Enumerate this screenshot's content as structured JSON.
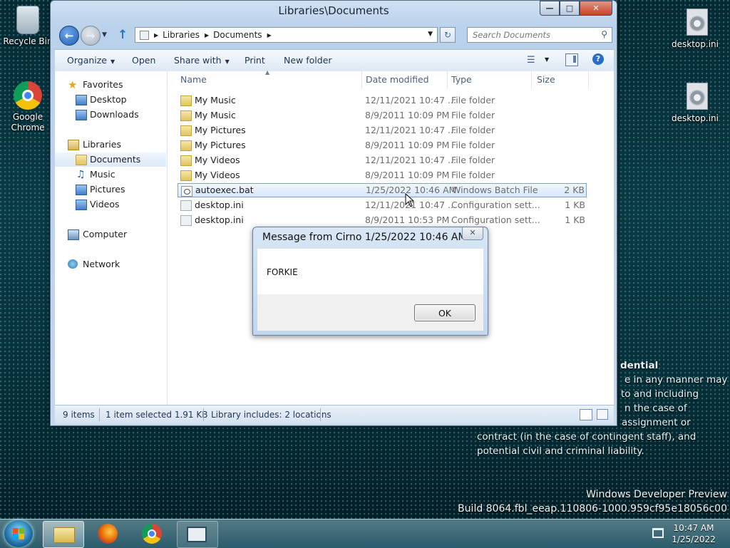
{
  "desktop": {
    "icons": [
      {
        "label": "Recycle Bin",
        "icon": "recycle-bin-icon"
      },
      {
        "label": "Google Chrome",
        "icon": "chrome-icon"
      },
      {
        "label": "desktop.ini",
        "icon": "settings-file-icon"
      },
      {
        "label": "desktop.ini",
        "icon": "settings-file-icon"
      }
    ],
    "wallpaper_text": {
      "title": "dential",
      "lines": [
        "e in any manner may",
        "to and including",
        "n the case of",
        "assignment or",
        "contract (in the case of contingent staff), and",
        "potential civil and criminal liability."
      ]
    },
    "watermark": [
      "Windows Developer Preview",
      "Build 8064.fbl_eeap.110806-1000.959cf95e18056c00"
    ]
  },
  "explorer": {
    "title": "Libraries\\Documents",
    "address": {
      "crumbs": [
        "Libraries",
        "Documents"
      ]
    },
    "search": {
      "placeholder": "Search Documents"
    },
    "toolbar": {
      "organize": "Organize",
      "open": "Open",
      "share_with": "Share with",
      "print": "Print",
      "new_folder": "New folder"
    },
    "nav": {
      "favorites": "Favorites",
      "desktop": "Desktop",
      "downloads": "Downloads",
      "libraries": "Libraries",
      "documents": "Documents",
      "music": "Music",
      "pictures": "Pictures",
      "videos": "Videos",
      "computer": "Computer",
      "network": "Network"
    },
    "columns": {
      "name": "Name",
      "date": "Date modified",
      "type": "Type",
      "size": "Size"
    },
    "files": [
      {
        "name": "My Music",
        "date": "12/11/2021 10:47 ...",
        "type": "File folder",
        "size": "",
        "kind": "folder"
      },
      {
        "name": "My Music",
        "date": "8/9/2011 10:09 PM",
        "type": "File folder",
        "size": "",
        "kind": "folder"
      },
      {
        "name": "My Pictures",
        "date": "12/11/2021 10:47 ...",
        "type": "File folder",
        "size": "",
        "kind": "folder"
      },
      {
        "name": "My Pictures",
        "date": "8/9/2011 10:09 PM",
        "type": "File folder",
        "size": "",
        "kind": "folder"
      },
      {
        "name": "My Videos",
        "date": "12/11/2021 10:47 ...",
        "type": "File folder",
        "size": "",
        "kind": "folder"
      },
      {
        "name": "My Videos",
        "date": "8/9/2011 10:09 PM",
        "type": "File folder",
        "size": "",
        "kind": "folder"
      },
      {
        "name": "autoexec.bat",
        "date": "1/25/2022 10:46 AM",
        "type": "Windows Batch File",
        "size": "2 KB",
        "kind": "bat",
        "selected": true
      },
      {
        "name": "desktop.ini",
        "date": "12/11/2021 10:47 ...",
        "type": "Configuration sett...",
        "size": "1 KB",
        "kind": "ini"
      },
      {
        "name": "desktop.ini",
        "date": "8/9/2011 10:53 PM",
        "type": "Configuration sett...",
        "size": "1 KB",
        "kind": "ini"
      }
    ],
    "status": {
      "count": "9 items",
      "selected": "1 item selected  1.91 KB",
      "library": "Library includes: 2 locations"
    }
  },
  "dialog": {
    "title": "Message from Cirno 1/25/2022 10:46 AM",
    "close": "✕",
    "message": "FORKIE",
    "ok": "OK"
  },
  "taskbar": {
    "apps": [
      "windows-explorer",
      "firefox",
      "chrome",
      "window-app"
    ],
    "clock": {
      "time": "10:47 AM",
      "date": "1/25/2022"
    }
  }
}
